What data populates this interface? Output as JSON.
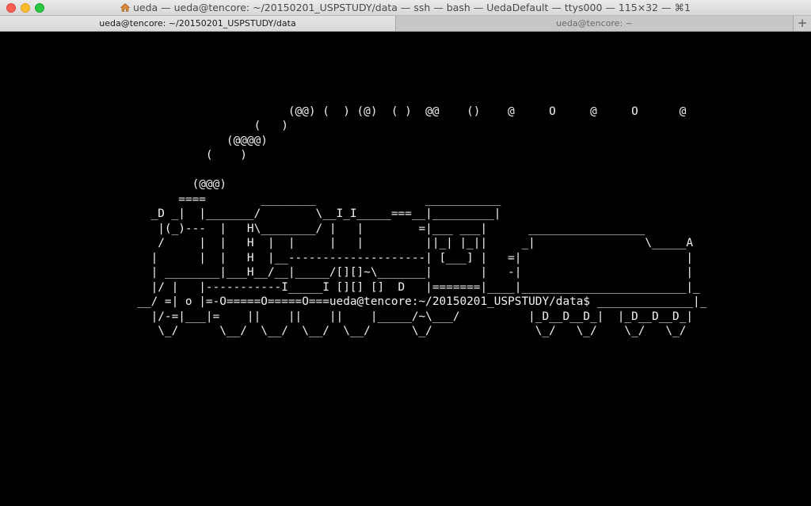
{
  "window": {
    "title": "ueda — ueda@tencore: ~/20150201_USPSTUDY/data — ssh — bash — UedaDefault — ttys000 — 115×32 — ⌘1"
  },
  "tabs": [
    {
      "label": "ueda@tencore: ~/20150201_USPSTUDY/data",
      "active": true
    },
    {
      "label": "ueda@tencore: ~",
      "active": false
    }
  ],
  "new_tab_label": "+",
  "terminal": {
    "lines": [
      "                                          (@@) (  ) (@)  ( )  @@    ()    @     O     @     O      @",
      "                                     (   )",
      "                                 (@@@@)",
      "                              (    )",
      "",
      "                            (@@@)",
      "                          ====        ________                ___________",
      "                      _D _|  |_______/        \\__I_I_____===__|_________|",
      "                       |(_)---  |   H\\________/ |   |        =|___ ___|      _________________",
      "                       /     |  |   H  |  |     |   |         ||_| |_||     _|                \\_____A",
      "                      |      |  |   H  |__--------------------| [___] |   =|                        |",
      "                      | ________|___H__/__|_____/[][]~\\_______|       |   -|                        |",
      "                      |/ |   |-----------I_____I [][] []  D   |=======|____|________________________|_",
      "                    __/ =| o |=-O=====O=====O===ueda@tencore:~/20150201_USPSTUDY/data$ ______________|_",
      "                      |/-=|___|=    ||    ||    ||    |_____/~\\___/          |_D__D__D_|  |_D__D__D_|",
      "                       \\_/      \\__/  \\__/  \\__/  \\__/      \\_/               \\_/   \\_/    \\_/   \\_/"
    ]
  },
  "colors": {
    "terminal_bg": "#000000",
    "terminal_fg": "#f2f2f2",
    "close": "#fc5f57",
    "minimize": "#fdbc2e",
    "maximize": "#28c840"
  },
  "icons": [
    "close-button",
    "minimize-button",
    "zoom-button",
    "home-icon",
    "new-tab-icon"
  ]
}
